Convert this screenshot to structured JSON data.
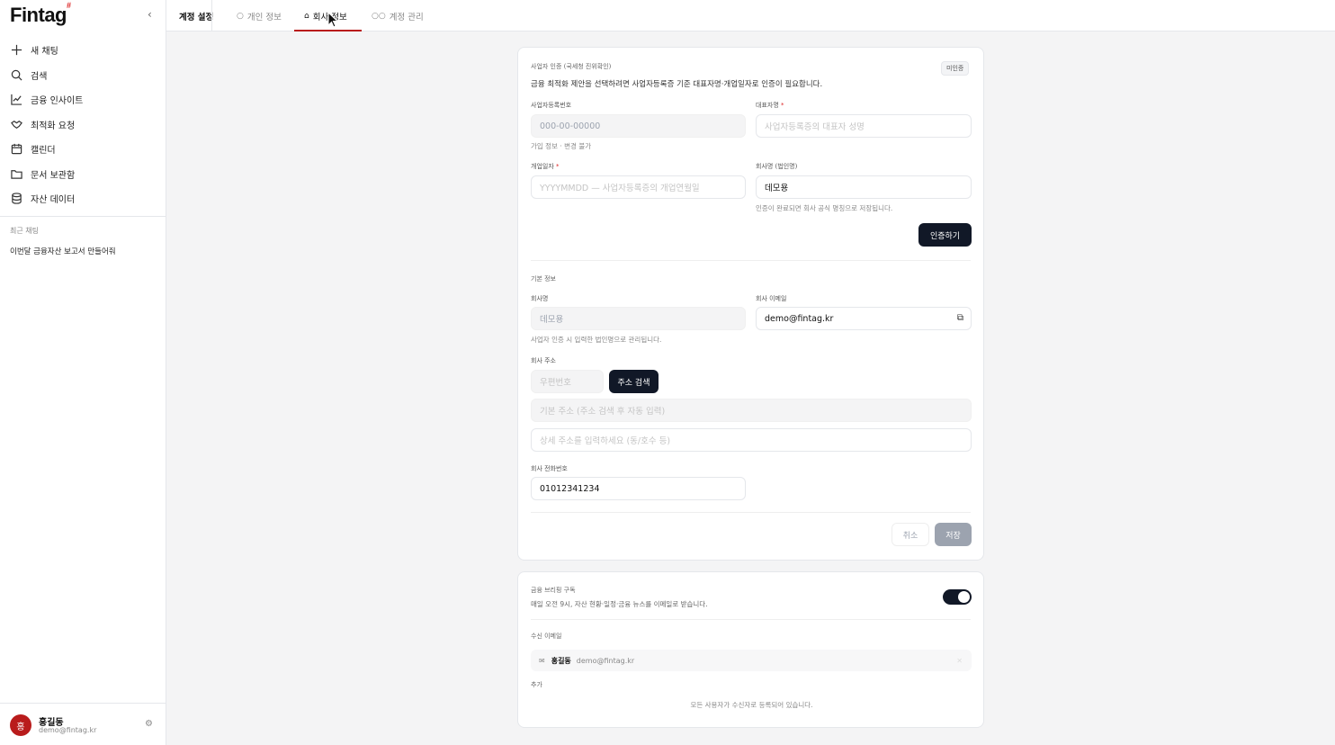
{
  "sidebar": {
    "logo": "Fintag",
    "logo_mark": "#",
    "items": [
      {
        "label": "새 채팅",
        "icon": "plus-icon"
      },
      {
        "label": "검색",
        "icon": "search-icon"
      },
      {
        "label": "금융 인사이트",
        "icon": "chart-icon"
      },
      {
        "label": "최적화 요청",
        "icon": "handshake-icon"
      },
      {
        "label": "캘린더",
        "icon": "calendar-icon"
      },
      {
        "label": "문서 보관함",
        "icon": "folder-icon"
      },
      {
        "label": "자산 데이터",
        "icon": "database-icon"
      }
    ],
    "recent_title": "최근 채팅",
    "recent_items": [
      "이번달 금융자산 보고서 만들어줘"
    ],
    "user": {
      "initial": "홍",
      "name": "홍길동",
      "email": "demo@fintag.kr"
    }
  },
  "tabs": {
    "title": "계정 설정",
    "items": [
      {
        "label": "개인 정보",
        "icon": "user-icon"
      },
      {
        "label": "회사 정보",
        "icon": "building-icon"
      },
      {
        "label": "계정 관리",
        "icon": "users-icon"
      }
    ]
  },
  "verify": {
    "title": "사업자 인증 (국세청 진위확인)",
    "status": "미인증",
    "desc": "금융 최적화 제안을 선택하려면 사업자등록증 기준 대표자명·개업일자로 인증이 필요합니다.",
    "brn_label": "사업자등록번호",
    "brn_value": "000-00-00000",
    "brn_hint": "가입 정보 · 변경 불가",
    "rep_label": "대표자명",
    "rep_placeholder": "사업자등록증의 대표자 성명",
    "open_label": "개업일자",
    "open_placeholder": "YYYYMMDD — 사업자등록증의 개업연월일",
    "corp_label": "회사명 (법인명)",
    "corp_value": "데모용",
    "corp_hint": "인증이 완료되면 회사 공식 명칭으로 저장됩니다.",
    "verify_button": "인증하기",
    "required_mark": "*"
  },
  "basic": {
    "title": "기본 정보",
    "company_label": "회사명",
    "company_value": "데모용",
    "company_hint": "사업자 인증 시 입력한 법인명으로 관리됩니다.",
    "email_label": "회사 이메일",
    "email_value": "demo@fintag.kr",
    "address_label": "회사 주소",
    "zip_placeholder": "우편번호",
    "address_search": "주소 검색",
    "address_placeholder": "기본 주소 (주소 검색 후 자동 입력)",
    "detail_placeholder": "상세 주소를 입력하세요 (동/호수 등)",
    "phone_label": "회사 전화번호",
    "phone_value": "01012341234",
    "cancel": "취소",
    "save": "저장"
  },
  "briefing": {
    "title": "금융 브리핑 구독",
    "desc": "매일 오전 9시, 자산 현황·일정·금융 뉴스를 이메일로 받습니다.",
    "enabled": true,
    "recipients_label": "수신 이메일",
    "recipient_name": "홍길동",
    "recipient_email": "demo@fintag.kr",
    "add_label": "추가",
    "all_registered": "모든 사용자가 수신자로 등록되어 있습니다."
  }
}
